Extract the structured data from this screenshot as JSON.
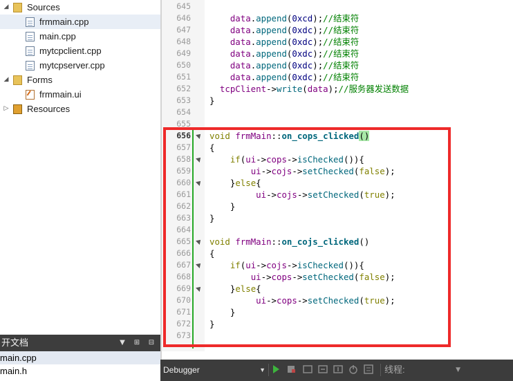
{
  "project_tree": {
    "items": [
      {
        "label": "Sources",
        "kind": "folder",
        "expanded": true
      },
      {
        "label": "frmmain.cpp",
        "kind": "file",
        "selected": true
      },
      {
        "label": "main.cpp",
        "kind": "file"
      },
      {
        "label": "mytcpclient.cpp",
        "kind": "file"
      },
      {
        "label": "mytcpserver.cpp",
        "kind": "file"
      },
      {
        "label": "Forms",
        "kind": "folder",
        "expanded": true
      },
      {
        "label": "frmmain.ui",
        "kind": "ui"
      },
      {
        "label": "Resources",
        "kind": "resources",
        "expanded": false
      }
    ]
  },
  "open_documents": {
    "title": "开文档",
    "items": [
      "main.cpp",
      "main.h"
    ]
  },
  "editor": {
    "lines": [
      {
        "n": "645",
        "code": ""
      },
      {
        "n": "646",
        "code": "    data.append(0xcd);//结束符"
      },
      {
        "n": "647",
        "code": "    data.append(0xdc);//结束符"
      },
      {
        "n": "648",
        "code": "    data.append(0xdc);//结束符"
      },
      {
        "n": "649",
        "code": "    data.append(0xdc);//结束符"
      },
      {
        "n": "650",
        "code": "    data.append(0xdc);//结束符"
      },
      {
        "n": "651",
        "code": "    data.append(0xdc);//结束符"
      },
      {
        "n": "652",
        "code": "  tcpClient->write(data);//服务器发送数据"
      },
      {
        "n": "653",
        "code": "}"
      },
      {
        "n": "654",
        "code": ""
      },
      {
        "n": "655",
        "code": ""
      },
      {
        "n": "656",
        "code": "void frmMain::on_cops_clicked()"
      },
      {
        "n": "657",
        "code": "{"
      },
      {
        "n": "658",
        "code": "    if(ui->cops->isChecked()){"
      },
      {
        "n": "659",
        "code": "        ui->cojs->setChecked(false);"
      },
      {
        "n": "660",
        "code": "    }else{"
      },
      {
        "n": "661",
        "code": "         ui->cojs->setChecked(true);"
      },
      {
        "n": "662",
        "code": "    }"
      },
      {
        "n": "663",
        "code": "}"
      },
      {
        "n": "664",
        "code": ""
      },
      {
        "n": "665",
        "code": "void frmMain::on_cojs_clicked()"
      },
      {
        "n": "666",
        "code": "{"
      },
      {
        "n": "667",
        "code": "    if(ui->cojs->isChecked()){"
      },
      {
        "n": "668",
        "code": "        ui->cops->setChecked(false);"
      },
      {
        "n": "669",
        "code": "    }else{"
      },
      {
        "n": "670",
        "code": "         ui->cops->setChecked(true);"
      },
      {
        "n": "671",
        "code": "    }"
      },
      {
        "n": "672",
        "code": "}"
      },
      {
        "n": "673",
        "code": ""
      }
    ],
    "current_line": "656",
    "fold_lines": [
      "656",
      "658",
      "660",
      "665",
      "667",
      "669"
    ]
  },
  "debugger_bar": {
    "mode": "Debugger",
    "thread_label": "线程:"
  },
  "colors": {
    "highlight_box": "#ee2a2a",
    "change_bar": "#27a827",
    "keyword": "#808000",
    "type": "#800080",
    "function": "#00677c",
    "comment": "#008000"
  }
}
